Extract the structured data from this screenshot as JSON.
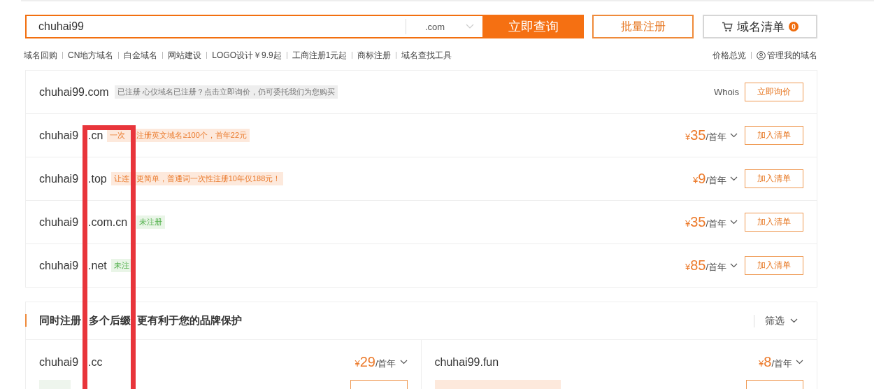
{
  "search": {
    "value": "chuhai99",
    "suffix": ".com",
    "button": "立即查询"
  },
  "batch_button": "批量注册",
  "cart": {
    "label": "域名清单",
    "count": "0"
  },
  "links": [
    "域名回购",
    "CN地方域名",
    "白金域名",
    "网站建设",
    "LOGO设计￥9.9起",
    "工商注册1元起",
    "商标注册",
    "域名查找工具"
  ],
  "right_links": [
    {
      "label": "价格总览",
      "kind": "text"
    },
    {
      "label": "管理我的域名",
      "kind": "user"
    }
  ],
  "results": [
    {
      "domain": [
        "chuhai99.com"
      ],
      "tag": {
        "kind": "taken",
        "parts": [
          "已注册 心仪域名已注册？点击立即询价，仍可委托我们为您购买"
        ]
      },
      "whois": "Whois",
      "button": "立即询价"
    },
    {
      "domain": [
        "chuhai9",
        ".cn"
      ],
      "tag": {
        "kind": "promo",
        "parts": [
          "一次",
          "注册英文域名≥100个，首年22元"
        ]
      },
      "currency": "¥",
      "price": "35",
      "unit": "/首年",
      "button": "加入清单"
    },
    {
      "domain": [
        "chuhai9",
        ".top"
      ],
      "tag": {
        "kind": "promo",
        "parts": [
          "让连",
          "更简单，普通词一次性注册10年仅188元！"
        ]
      },
      "currency": "¥",
      "price": "9",
      "unit": "/首年",
      "button": "加入清单"
    },
    {
      "domain": [
        "chuhai9",
        ".com.cn"
      ],
      "tag": {
        "kind": "available",
        "parts": [
          "未注册"
        ]
      },
      "currency": "¥",
      "price": "35",
      "unit": "/首年",
      "button": "加入清单"
    },
    {
      "domain": [
        "chuhai9",
        ".net"
      ],
      "tag": {
        "kind": "available",
        "parts": [
          "未注"
        ]
      },
      "currency": "¥",
      "price": "85",
      "unit": "/首年",
      "button": "加入清单"
    }
  ],
  "suggest": {
    "title_parts": [
      "同时注册",
      "多个后缀",
      "更有利于您的品牌保护"
    ],
    "filter": "筛选",
    "items": [
      {
        "domain": [
          "chuhai9",
          ".cc"
        ],
        "currency": "¥",
        "price": "29",
        "unit": "/首年",
        "tag": {
          "kind": "available"
        }
      },
      {
        "domain": [
          "chuhai99.fun"
        ],
        "currency": "¥",
        "price": "8",
        "unit": "/首年",
        "tag": {
          "kind": "promo"
        }
      }
    ]
  }
}
